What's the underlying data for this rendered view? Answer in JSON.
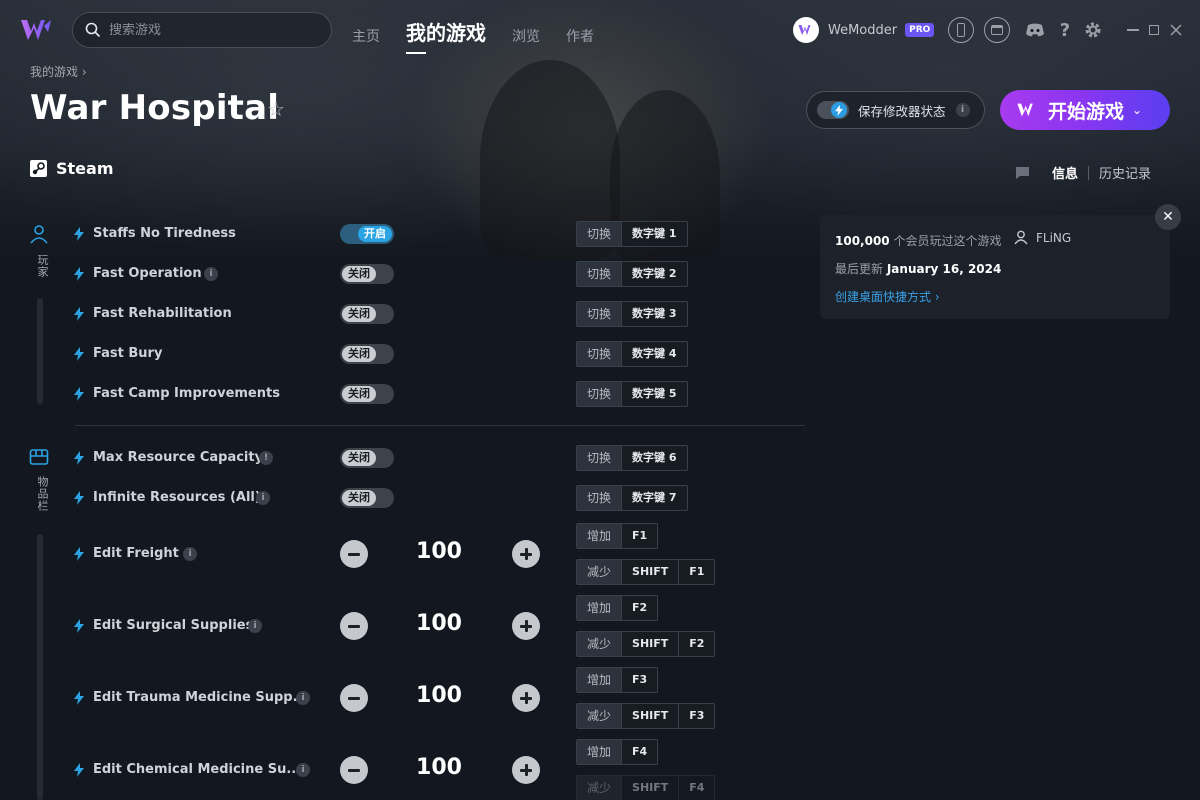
{
  "titlebar": {
    "search_placeholder": "搜索游戏",
    "nav": [
      "主页",
      "我的游戏",
      "浏览",
      "作者"
    ],
    "user_name": "WeModder",
    "pro_badge": "PRO"
  },
  "header": {
    "breadcrumb": "我的游戏 ›",
    "title": "War Hospital",
    "platform": "Steam",
    "save_state_label": "保存修改器状态",
    "play_label": "开始游戏",
    "tabs": [
      "信息",
      "历史记录"
    ]
  },
  "categories": [
    "玩家",
    "物品栏"
  ],
  "cheats": [
    {
      "name": "Staffs No Tiredness",
      "state": "开启",
      "action": "切换",
      "keys": [
        "数字键 1"
      ]
    },
    {
      "name": "Fast Operation",
      "state": "关闭",
      "action": "切换",
      "keys": [
        "数字键 2"
      ],
      "badge": "i"
    },
    {
      "name": "Fast Rehabilitation",
      "state": "关闭",
      "action": "切换",
      "keys": [
        "数字键 3"
      ]
    },
    {
      "name": "Fast Bury",
      "state": "关闭",
      "action": "切换",
      "keys": [
        "数字键 4"
      ]
    },
    {
      "name": "Fast Camp Improvements",
      "state": "关闭",
      "action": "切换",
      "keys": [
        "数字键 5"
      ]
    },
    {
      "name": "Max Resource Capacity",
      "state": "关闭",
      "action": "切换",
      "keys": [
        "数字键 6"
      ],
      "badge": "!"
    },
    {
      "name": "Infinite Resources (All)",
      "state": "关闭",
      "action": "切换",
      "keys": [
        "数字键 7"
      ],
      "badge": "i"
    }
  ],
  "numeric_cheats": [
    {
      "name": "Edit Freight",
      "value": "100",
      "inc_label": "增加",
      "inc_keys": [
        "F1"
      ],
      "dec_label": "减少",
      "dec_keys": [
        "SHIFT",
        "F1"
      ]
    },
    {
      "name": "Edit Surgical Supplies",
      "value": "100",
      "inc_label": "增加",
      "inc_keys": [
        "F2"
      ],
      "dec_label": "减少",
      "dec_keys": [
        "SHIFT",
        "F2"
      ]
    },
    {
      "name": "Edit Trauma Medicine Supp...",
      "value": "100",
      "inc_label": "增加",
      "inc_keys": [
        "F3"
      ],
      "dec_label": "减少",
      "dec_keys": [
        "SHIFT",
        "F3"
      ]
    },
    {
      "name": "Edit Chemical Medicine Su...",
      "value": "100",
      "inc_label": "增加",
      "inc_keys": [
        "F4"
      ],
      "dec_label": "减少",
      "dec_keys": [
        "SHIFT",
        "F4"
      ]
    }
  ],
  "info_card": {
    "players_count": "100,000",
    "players_text": "个会员玩过这个游戏",
    "author": "FLiNG",
    "updated_label": "最后更新",
    "updated_date": "January 16, 2024",
    "shortcut_link": "创建桌面快捷方式 ›"
  },
  "colors": {
    "accent": "#2aa4e3",
    "play_gradient_start": "#a73bf0",
    "play_gradient_end": "#5a3ff0",
    "pro": "#6b55f3"
  }
}
